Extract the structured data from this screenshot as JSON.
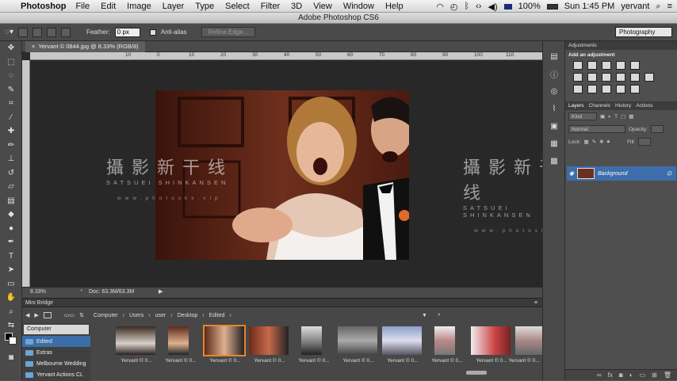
{
  "menubar": {
    "app": "Photoshop",
    "items": [
      "File",
      "Edit",
      "Image",
      "Layer",
      "Type",
      "Select",
      "Filter",
      "3D",
      "View",
      "Window",
      "Help"
    ],
    "battery": "100%",
    "clock": "Sun 1:45 PM",
    "user": "yervant"
  },
  "titlebar": {
    "title": "Adobe Photoshop CS6"
  },
  "options": {
    "feather_label": "Feather:",
    "feather_value": "0 px",
    "antialias_label": "Anti-alias",
    "refine_label": "Refine Edge...",
    "workspace": "Photography"
  },
  "document": {
    "tab_title": "Yervant © 0844.jpg @ 8.33% (RGB/8)",
    "zoom": "8.33%",
    "doc_info": "Doc: 63.3M/63.3M",
    "ruler_labels": [
      "0",
      "10",
      "20",
      "30",
      "40",
      "50",
      "60",
      "70",
      "80",
      "90",
      "100",
      "110"
    ],
    "ruler_neg": "10"
  },
  "watermark": {
    "title": "攝影新干线",
    "sub": "SATSUEI SHINKANSEN",
    "url": "www.photoskx.vip"
  },
  "minibridge": {
    "title": "Mini Bridge",
    "breadcrumb": [
      "Computer",
      "Users",
      "user",
      "Desktop",
      "Edited"
    ],
    "location": "Computer",
    "folders": [
      "Edited",
      "Extras",
      "Melbourne Wedding",
      "Yervant Actions CL"
    ],
    "thumb_label": "Yervant © 0..."
  },
  "panels": {
    "adjustments_title": "Adjustments",
    "add_adjustment": "Add an adjustment",
    "layers_tabs": [
      "Layers",
      "Channels",
      "History",
      "Actions"
    ],
    "kind": "Kind",
    "blend": "Normal",
    "opacity_label": "Opacity:",
    "lock_label": "Lock:",
    "fill_label": "Fill:",
    "layer_name": "Background"
  },
  "colors": {
    "ui_dark": "#4a4a4a",
    "canvas_bg": "#282828",
    "selection": "#3d6ea9"
  }
}
